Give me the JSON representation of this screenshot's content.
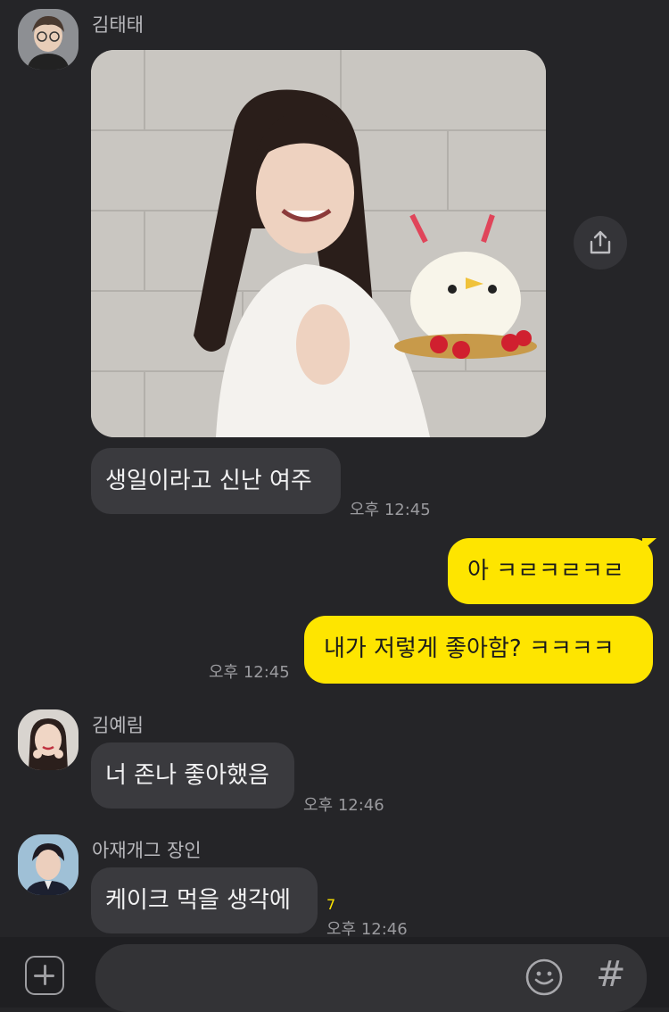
{
  "messages": {
    "m1": {
      "sender": "김태태",
      "bubble": "생일이라고 신난 여주",
      "time": "오후 12:45"
    },
    "m2": {
      "bubble": "아 ㅋㄹㅋㄹㅋㄹ"
    },
    "m3": {
      "bubble": "내가 저렇게 좋아함? ㅋㅋㅋㅋ",
      "time": "오후 12:45"
    },
    "m4": {
      "sender": "김예림",
      "bubble": "너 존나 좋아했음",
      "time": "오후 12:46"
    },
    "m5": {
      "sender": "아재개그 장인",
      "bubble": "케이크 먹을 생각에",
      "time": "오후 12:46",
      "unread": "7"
    }
  },
  "input": {
    "placeholder": "",
    "hash_label": "#"
  },
  "icons": {
    "share": "share-icon",
    "plus": "plus-icon",
    "emoji": "emoji-icon",
    "hashtag": "hashtag-icon"
  },
  "colors": {
    "background": "#252528",
    "incoming_bubble": "#3a3a3e",
    "outgoing_bubble": "#fee500",
    "unread": "#fee500"
  }
}
